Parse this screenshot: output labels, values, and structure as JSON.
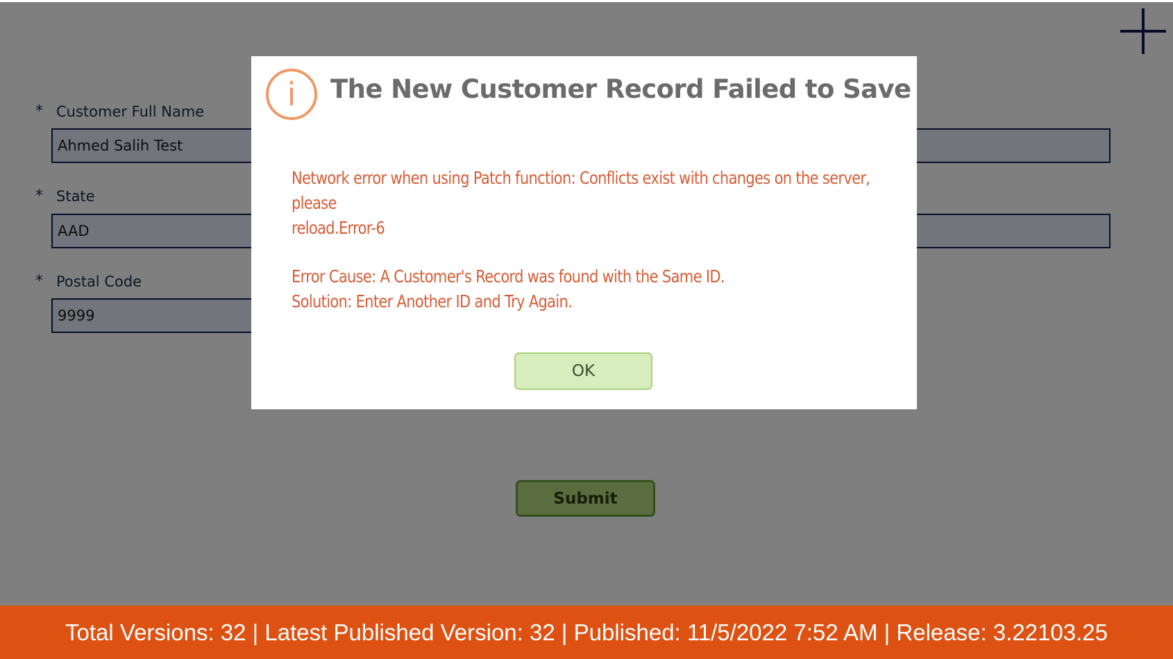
{
  "form": {
    "fields": [
      {
        "label": "Customer Full Name",
        "required_mark": "*",
        "value": "Ahmed Salih Test"
      },
      {
        "label": "State",
        "required_mark": "*",
        "value": "AAD"
      },
      {
        "label": "Postal Code",
        "required_mark": "*",
        "value": "9999"
      }
    ],
    "submit_label": "Submit"
  },
  "toolbar": {
    "add_icon": "plus-icon"
  },
  "dialog": {
    "icon": "info-icon",
    "icon_glyph": "i",
    "title": "The New Customer Record Failed to Save",
    "message_lines": [
      "Network error when using Patch function: Conflicts exist with changes on the server, please",
      "reload.Error-6"
    ],
    "cause": "Error Cause: A Customer's Record was found with the Same ID.",
    "solution": "Solution: Enter Another ID and Try Again.",
    "ok_label": "OK"
  },
  "footer": {
    "text": "Total Versions: 32 | Latest Published Version: 32 | Published: 11/5/2022 7:52 AM | Release: 3.22103.25"
  },
  "colors": {
    "footer_bg": "#dd5213",
    "input_border": "#0f1a52",
    "dialog_message": "#d45e38",
    "info_icon": "#ee9a68",
    "submit_bg": "#b5db7f",
    "ok_bg": "#d8edbe"
  }
}
